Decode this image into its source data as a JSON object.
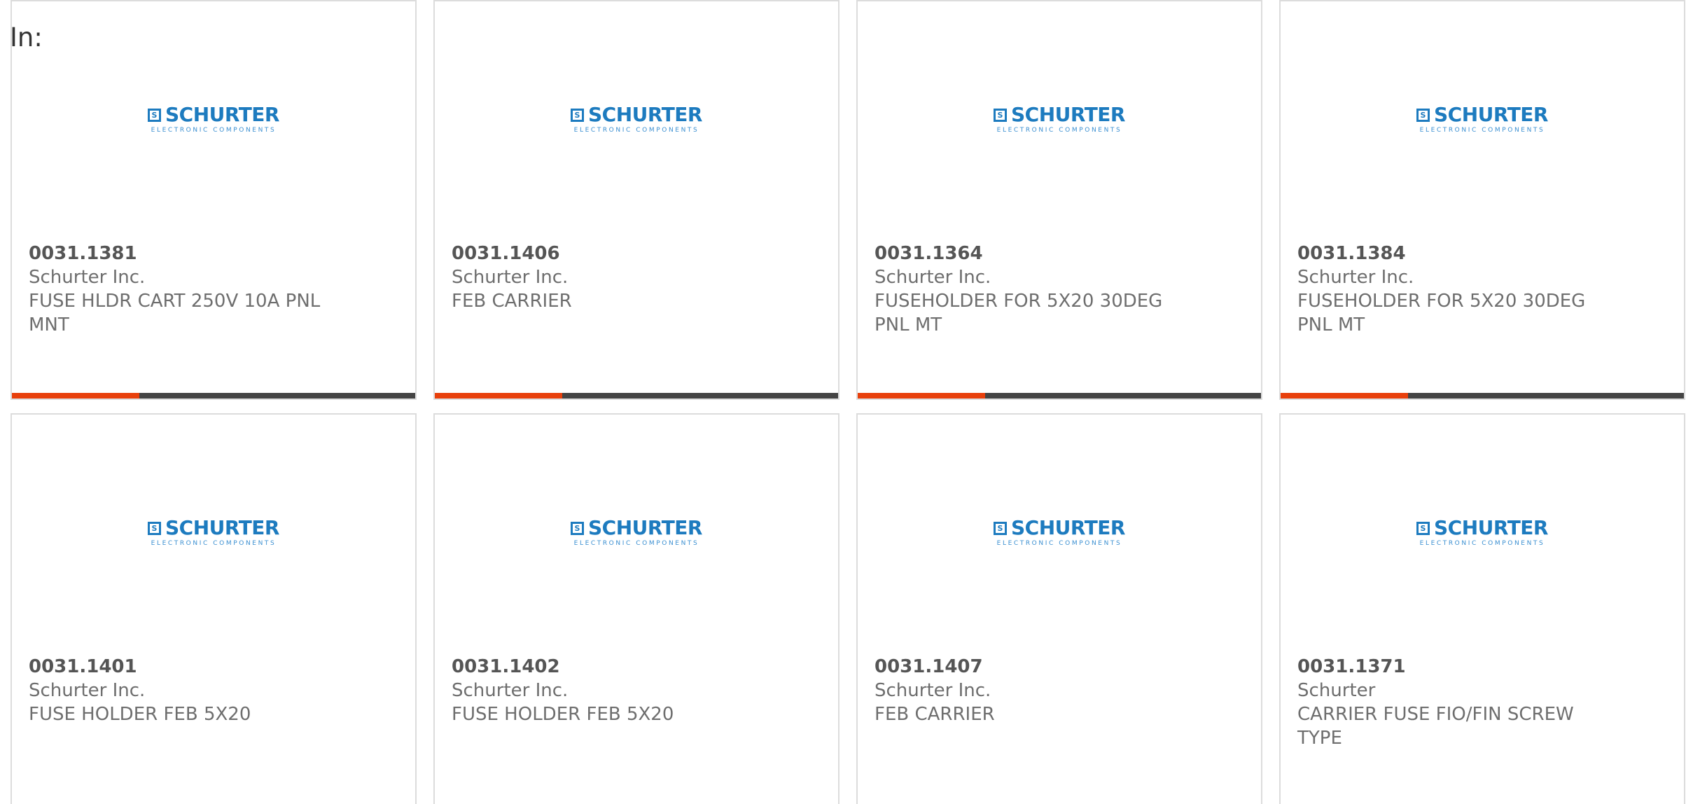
{
  "page": {
    "in_label": "In:"
  },
  "logo": {
    "box_letter": "S",
    "word": "SCHURTER",
    "sub": "ELECTRONIC COMPONENTS",
    "color": "#1d7bbf"
  },
  "colors": {
    "accent": "#e8400c",
    "bar_dark": "#444444"
  },
  "products": [
    {
      "part": "0031.1381",
      "manufacturer": "Schurter Inc.",
      "description": "FUSE HLDR CART 250V 10A PNL MNT"
    },
    {
      "part": "0031.1406",
      "manufacturer": "Schurter Inc.",
      "description": "FEB CARRIER"
    },
    {
      "part": "0031.1364",
      "manufacturer": "Schurter Inc.",
      "description": "FUSEHOLDER FOR 5X20 30DEG PNL MT"
    },
    {
      "part": "0031.1384",
      "manufacturer": "Schurter Inc.",
      "description": "FUSEHOLDER FOR 5X20 30DEG PNL MT"
    },
    {
      "part": "0031.1401",
      "manufacturer": "Schurter Inc.",
      "description": "FUSE HOLDER FEB 5X20"
    },
    {
      "part": "0031.1402",
      "manufacturer": "Schurter Inc.",
      "description": "FUSE HOLDER FEB 5X20"
    },
    {
      "part": "0031.1407",
      "manufacturer": "Schurter Inc.",
      "description": "FEB CARRIER"
    },
    {
      "part": "0031.1371",
      "manufacturer": "Schurter",
      "description": "CARRIER FUSE FIO/FIN SCREW TYPE"
    }
  ]
}
